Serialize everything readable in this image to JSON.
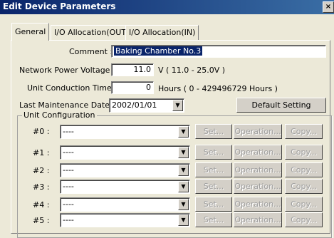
{
  "window": {
    "title": "Edit Device Parameters",
    "close_glyph": "×"
  },
  "tabs": [
    {
      "label": "General"
    },
    {
      "label": "I/O Allocation(OUT)"
    },
    {
      "label": "I/O Allocation(IN)"
    }
  ],
  "general": {
    "comment_label": "Comment :",
    "comment_value": "Baking Chamber No.3",
    "voltage_label": "Network Power Voltage :",
    "voltage_value": "11.0",
    "voltage_unit": "V ( 11.0 - 25.0V )",
    "conduction_label": "Unit Conduction Time :",
    "conduction_value": "0",
    "conduction_unit": "Hours ( 0 - 429496729 Hours )",
    "maintenance_label": "Last Maintenance Date :",
    "maintenance_value": "2002/01/01",
    "default_setting_label": "Default Setting"
  },
  "unit_config": {
    "label": "Unit Configuration",
    "rows": [
      {
        "label": "#0 :",
        "value": "----",
        "set": "Set...",
        "operation": "Operation...",
        "copy": "Copy..."
      },
      {
        "label": "#1 :",
        "value": "----",
        "set": "Set...",
        "operation": "Operation...",
        "copy": "Copy..."
      },
      {
        "label": "#2 :",
        "value": "----",
        "set": "Set...",
        "operation": "Operation...",
        "copy": "Copy..."
      },
      {
        "label": "#3 :",
        "value": "----",
        "set": "Set...",
        "operation": "Operation...",
        "copy": "Copy..."
      },
      {
        "label": "#4 :",
        "value": "----",
        "set": "Set...",
        "operation": "Operation...",
        "copy": "Copy..."
      },
      {
        "label": "#5 :",
        "value": "----",
        "set": "Set...",
        "operation": "Operation...",
        "copy": "Copy..."
      }
    ]
  }
}
